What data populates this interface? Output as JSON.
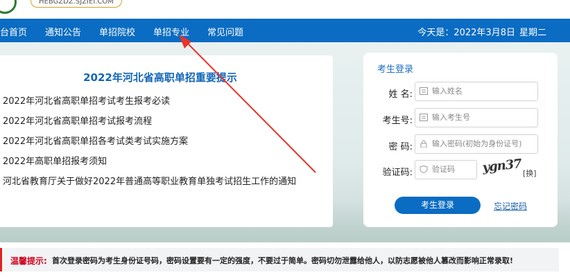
{
  "header": {
    "site_url": "HEBGZDZ.SJZIEI.COM"
  },
  "nav": {
    "items": [
      {
        "label": "台首页"
      },
      {
        "label": "通知公告"
      },
      {
        "label": "单招院校"
      },
      {
        "label": "单招专业"
      },
      {
        "label": "常见问题"
      }
    ],
    "date_label": "今天是：2022年3月8日",
    "weekday": "星期二"
  },
  "notice": {
    "title": "2022年河北省高职单招重要提示",
    "items": [
      {
        "text": "2022年河北省高职单招考试考生报考必读"
      },
      {
        "text": "2022年河北省高职单招考试报考流程"
      },
      {
        "text": "2022年河北省高职单招各考试类考试实施方案"
      },
      {
        "text": "2022年高职单招报考须知"
      },
      {
        "text": "河北省教育厅关于做好2022年普通高等职业教育单独考试招生工作的通知"
      }
    ]
  },
  "login": {
    "title": "考生登录",
    "name_label": "姓  名:",
    "name_placeholder": "输入姓名",
    "id_label": "考生号:",
    "id_placeholder": "输入考生号",
    "password_label": "密  码:",
    "password_placeholder": "输入密码(初始为身份证号)",
    "captcha_label": "验证码:",
    "captcha_placeholder": "验证码",
    "captcha_text": "ygn37",
    "refresh_label": "[换]",
    "submit_label": "考生登录",
    "forgot_label": "忘记密码"
  },
  "tip": {
    "label": "温馨提示:",
    "text": "首次登录密码为考生身份证号码，密码设置要有一定的强度，不要过于简单。密码切勿泄露给他人，以防志愿被他人篡改而影响正常录取!"
  },
  "colors": {
    "nav_bg": "#0a6cc2",
    "title_blue": "#1266b9",
    "tip_red": "#d0021b",
    "arrow_red": "#e8332a"
  }
}
